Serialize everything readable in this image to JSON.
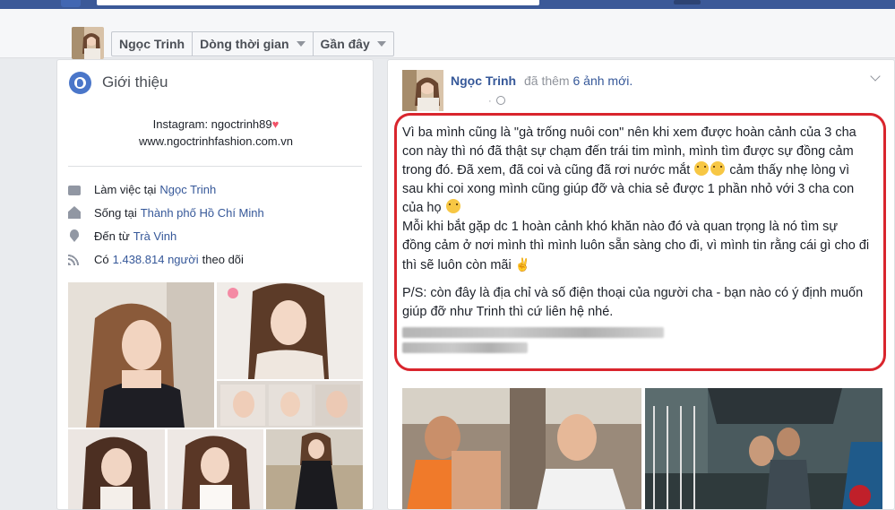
{
  "subheader": {
    "name_tab": "Ngọc Trinh",
    "timeline_tab": "Dòng thời gian",
    "recent_tab": "Gần đây"
  },
  "intro": {
    "title": "Giới thiệu",
    "instagram": "Instagram: ngoctrinh89",
    "website": "www.ngoctrinhfashion.com.vn",
    "work_prefix": "Làm việc tại",
    "work_link": "Ngọc Trinh",
    "lives_prefix": "Sống tại",
    "lives_link": "Thành phố Hồ Chí Minh",
    "from_prefix": "Đến từ",
    "from_link": "Trà Vinh",
    "followers_prefix": "Có",
    "followers_link": "1.438.814 người",
    "followers_suffix": "theo dõi"
  },
  "post": {
    "author": "Ngọc Trinh",
    "action_prefix": "đã thêm",
    "action_count": "6 ảnh mới.",
    "meta_sep": "·",
    "para1": "Vì ba mình cũng là \"gà trống nuôi con\" nên khi xem được hoàn cảnh của 3 cha con này thì nó đã thật sự chạm đến trái tim mình, mình tìm được sự đồng cảm trong đó. Đã xem, đã coi và cũng đã rơi nước mắt",
    "para1b": "cảm thấy nhẹ lòng vì sau khi coi xong mình cũng giúp đỡ và chia sẻ được 1 phần nhỏ với 3 cha con của họ",
    "para1c": "Mỗi khi bắt gặp dc 1 hoàn cảnh khó khăn nào đó và quan trọng là nó tìm sự đồng cảm ở nơi mình thì mình luôn sẵn sàng cho đi, vì mình tin rằng cái gì cho đi thì sẽ luôn còn mãi",
    "para2": "P/S: còn đây là địa chỉ và số điện thoại của người cha - bạn nào có ý định muốn giúp đỡ như Trinh thì cứ liên hệ nhé."
  },
  "colors": {
    "facebook_blue": "#3b5998",
    "link": "#365899",
    "highlight_outline": "#d9252d"
  },
  "icons": [
    "globe-icon",
    "briefcase-icon",
    "home-icon",
    "location-pin-icon",
    "rss-icon",
    "caret-down-icon",
    "chevron-down-icon",
    "heart-icon",
    "crying-emoji-icon",
    "smile-emoji-icon",
    "peace-hand-icon"
  ]
}
